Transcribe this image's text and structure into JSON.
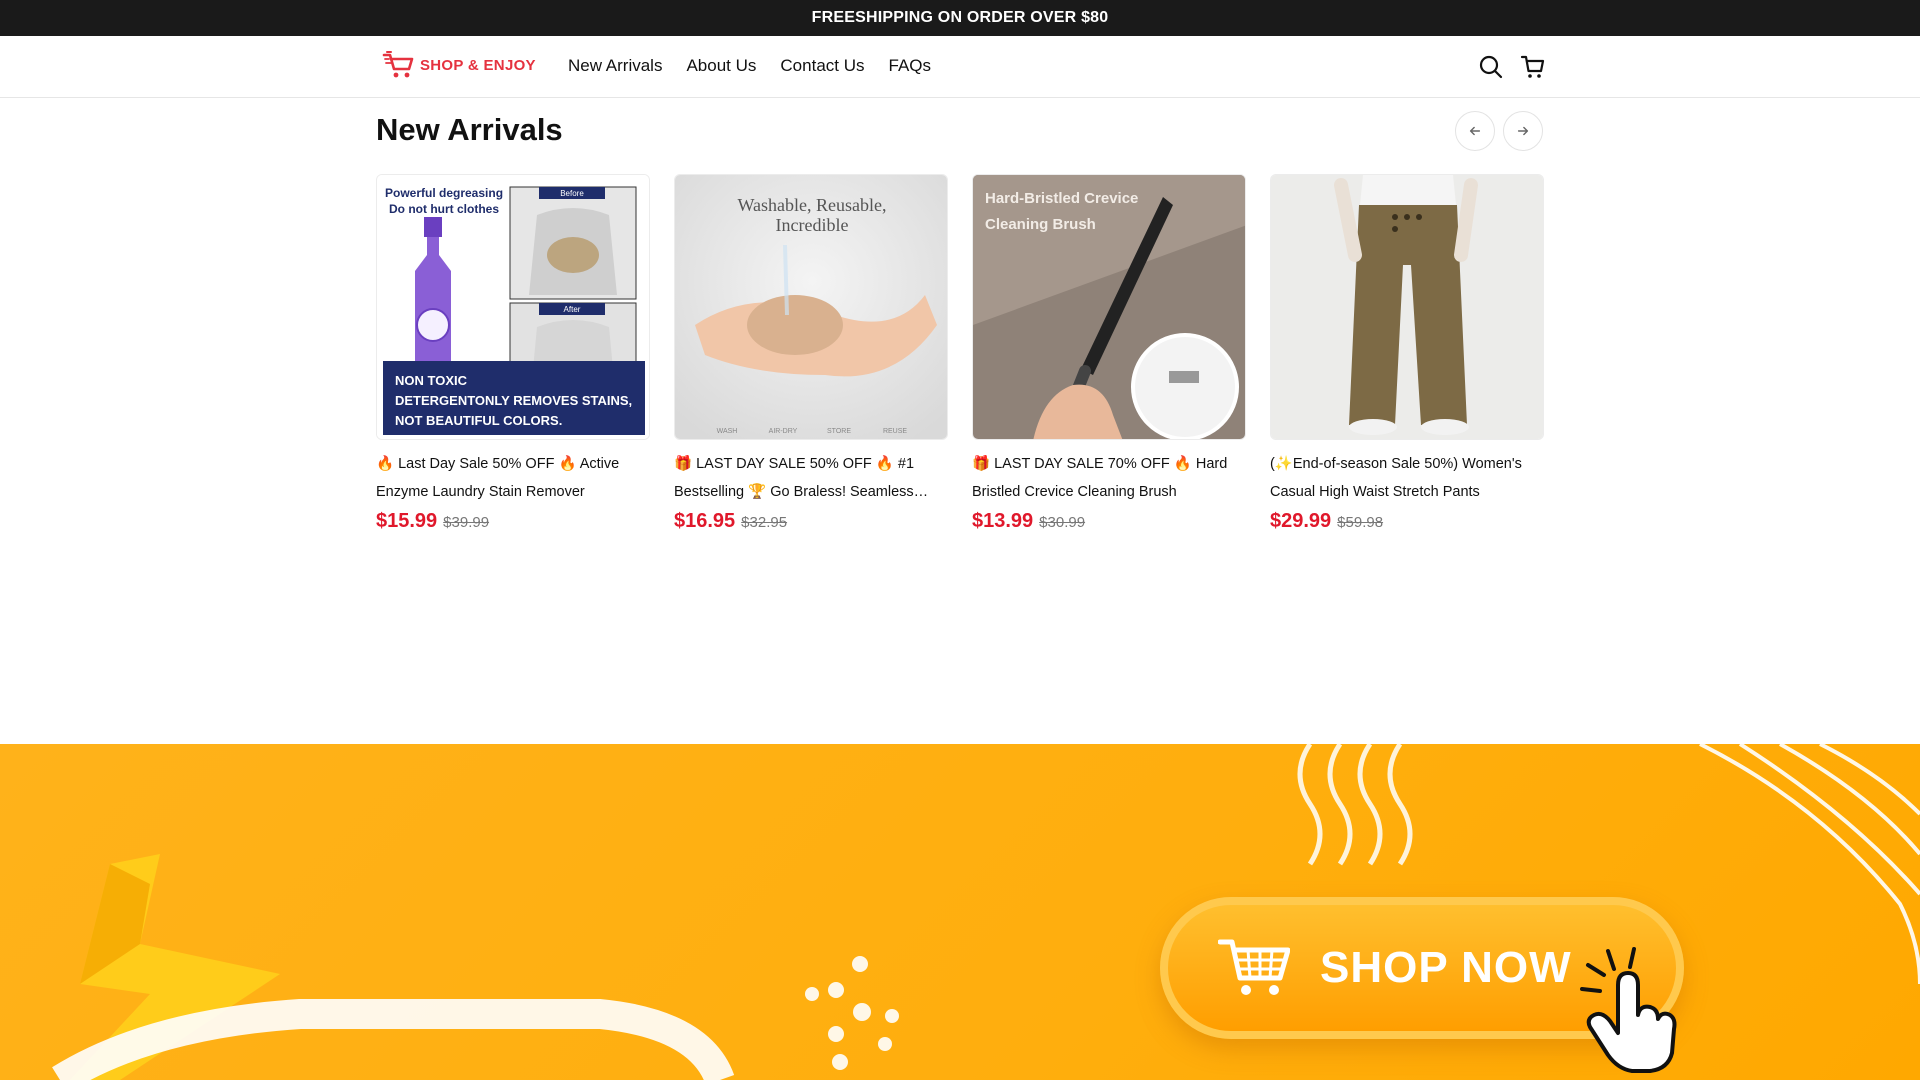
{
  "announcement": "FREESHIPPING ON ORDER OVER $80",
  "brand": {
    "name": "SHOP & ENJOY",
    "color": "#e5323f"
  },
  "nav": [
    {
      "label": "New Arrivals"
    },
    {
      "label": "About Us"
    },
    {
      "label": "Contact Us"
    },
    {
      "label": "FAQs"
    }
  ],
  "header_icons": [
    "search-icon",
    "cart-icon"
  ],
  "section": {
    "title": "New Arrivals"
  },
  "products": [
    {
      "title": "🔥 Last Day Sale 50% OFF 🔥 Active Enzyme Laundry Stain Remover",
      "price": "$15.99",
      "old_price": "$39.99",
      "image_text": [
        "Powerful degreasing",
        "Do not hurt clothes",
        "Before",
        "After",
        "NON TOXIC",
        "DETERGENTONLY REMOVES STAINS,",
        "NOT BEAUTIFUL COLORS."
      ]
    },
    {
      "title": "🎁 LAST DAY SALE 50% OFF 🔥 #1 Bestselling 🏆 Go Braless! Seamless…",
      "price": "$16.95",
      "old_price": "$32.95",
      "image_text": [
        "Washable, Reusable,",
        "Incredible",
        "WASH",
        "AIR-DRY",
        "STORE",
        "REUSE"
      ]
    },
    {
      "title": "🎁 LAST DAY SALE 70% OFF 🔥 Hard Bristled Crevice Cleaning Brush",
      "price": "$13.99",
      "old_price": "$30.99",
      "image_text": [
        "Hard-Bristled Crevice",
        "Cleaning Brush"
      ]
    },
    {
      "title": "(✨End-of-season Sale 50%) Women's Casual High Waist Stretch Pants",
      "price": "$29.99",
      "old_price": "$59.98",
      "image_text": []
    }
  ],
  "banner": {
    "cta_label": "SHOP NOW",
    "color": "#ffae0d"
  },
  "colors": {
    "price": "#e0182b",
    "topbar": "#1a1a1a"
  }
}
